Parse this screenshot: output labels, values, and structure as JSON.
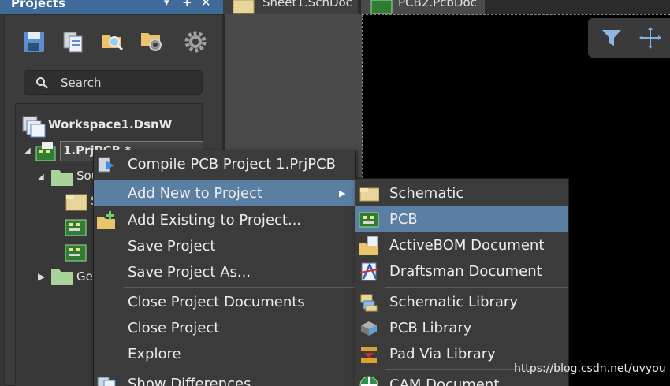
{
  "panel": {
    "title": "Projects",
    "dropdown_glyph": "▾",
    "add_glyph": "+",
    "close_glyph": "✕",
    "toolbar_icons": [
      "save-icon",
      "copy-documents-icon",
      "open-folder-search-icon",
      "folder-settings-icon",
      "gear-icon"
    ],
    "search_placeholder": "Search",
    "tree": {
      "workspace": "Workspace1.DsnW",
      "project": "1.PrjPCB *",
      "source_folder": "Sou",
      "source_child": "S",
      "generated_folder": "Ge"
    }
  },
  "tabs": [
    {
      "label": "Sheet1.SchDoc",
      "icon": "schematic-doc-icon"
    },
    {
      "label": "PCB2.PcbDoc",
      "icon": "pcb-doc-icon"
    }
  ],
  "pcb_toolbar": {
    "icons": [
      "filter-icon",
      "crosshair-move-icon"
    ]
  },
  "context_menu": {
    "items": [
      {
        "label": "Compile PCB Project 1.PrjPCB",
        "icon": "compile-icon",
        "accel": "C"
      },
      {
        "label": "Add New to Project",
        "icon": "",
        "accel": "N",
        "submenu": true,
        "highlighted": true
      },
      {
        "label": "Add Existing to Project...",
        "icon": "add-existing-icon",
        "accel": "E"
      },
      {
        "label": "Save Project",
        "icon": ""
      },
      {
        "label": "Save Project As...",
        "icon": ""
      },
      {
        "label": "Close Project Documents",
        "icon": "",
        "accel": "l"
      },
      {
        "label": "Close Project",
        "icon": ""
      },
      {
        "label": "Explore",
        "icon": ""
      },
      {
        "label": "Show Differences",
        "icon": "show-differences-icon"
      }
    ],
    "submenu_arrow": "▶"
  },
  "submenu": {
    "items": [
      {
        "label": "Schematic",
        "icon": "schematic-icon",
        "accel": "S"
      },
      {
        "label": "PCB",
        "icon": "pcb-icon",
        "accel": "P",
        "highlighted": true
      },
      {
        "label": "ActiveBOM Document",
        "icon": "activebom-icon",
        "accel": "B"
      },
      {
        "label": "Draftsman Document",
        "icon": "draftsman-icon"
      },
      {
        "label": "Schematic Library",
        "icon": "schematic-library-icon",
        "accel": "L"
      },
      {
        "label": "PCB Library",
        "icon": "pcb-library-icon",
        "accel": "y"
      },
      {
        "label": "Pad Via Library",
        "icon": "pad-via-library-icon",
        "accel": "V"
      },
      {
        "label": "CAM Document",
        "icon": "cam-document-icon"
      }
    ]
  },
  "watermark": "https://blog.csdn.net/uvyou",
  "colors": {
    "highlight": "#5b7ea3",
    "panel_header": "#3f6a9a",
    "menu_bg": "#3b3b3b"
  }
}
